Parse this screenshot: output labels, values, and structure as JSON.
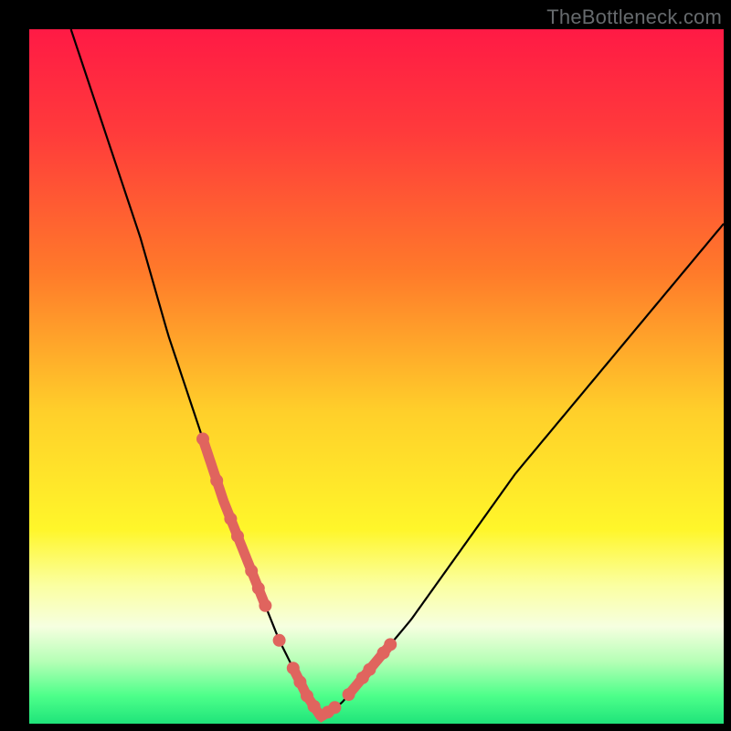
{
  "watermark": "TheBottleneck.com",
  "colors": {
    "frame": "#000000",
    "gradient_stops": [
      {
        "offset": 0.0,
        "color": "#ff1a45"
      },
      {
        "offset": 0.15,
        "color": "#ff3b3b"
      },
      {
        "offset": 0.35,
        "color": "#ff7a2a"
      },
      {
        "offset": 0.55,
        "color": "#ffcf2a"
      },
      {
        "offset": 0.72,
        "color": "#fff62a"
      },
      {
        "offset": 0.8,
        "color": "#fbffa0"
      },
      {
        "offset": 0.86,
        "color": "#f6ffe0"
      },
      {
        "offset": 0.91,
        "color": "#b6ffb6"
      },
      {
        "offset": 0.96,
        "color": "#4dff8a"
      },
      {
        "offset": 1.0,
        "color": "#1fe47a"
      }
    ],
    "curve": "#000000",
    "marker": "#e0645e"
  },
  "chart_data": {
    "type": "line",
    "title": "",
    "xlabel": "",
    "ylabel": "",
    "xlim": [
      0,
      100
    ],
    "ylim": [
      0,
      100
    ],
    "series": [
      {
        "name": "bottleneck-curve",
        "x": [
          6,
          8,
          10,
          12,
          14,
          16,
          18,
          20,
          22,
          24,
          26,
          28,
          30,
          32,
          34,
          36,
          38,
          40,
          42,
          45,
          50,
          55,
          60,
          65,
          70,
          75,
          80,
          85,
          90,
          95,
          100
        ],
        "values": [
          100,
          94,
          88,
          82,
          76,
          70,
          63,
          56,
          50,
          44,
          38,
          32,
          27,
          22,
          17,
          12,
          8,
          4,
          1,
          3,
          9,
          15,
          22,
          29,
          36,
          42,
          48,
          54,
          60,
          66,
          72
        ]
      }
    ],
    "markers": {
      "note": "highlighted segments and points along the curve (pink)",
      "segments": [
        {
          "x0": 25,
          "x1": 30
        },
        {
          "x0": 30,
          "x1": 34
        },
        {
          "x0": 38,
          "x1": 44
        },
        {
          "x0": 46,
          "x1": 52
        }
      ],
      "points_x": [
        25,
        27,
        29,
        30,
        32,
        33,
        34,
        36,
        38,
        39,
        40,
        41,
        43,
        44,
        46,
        48,
        49,
        51,
        52
      ]
    }
  }
}
